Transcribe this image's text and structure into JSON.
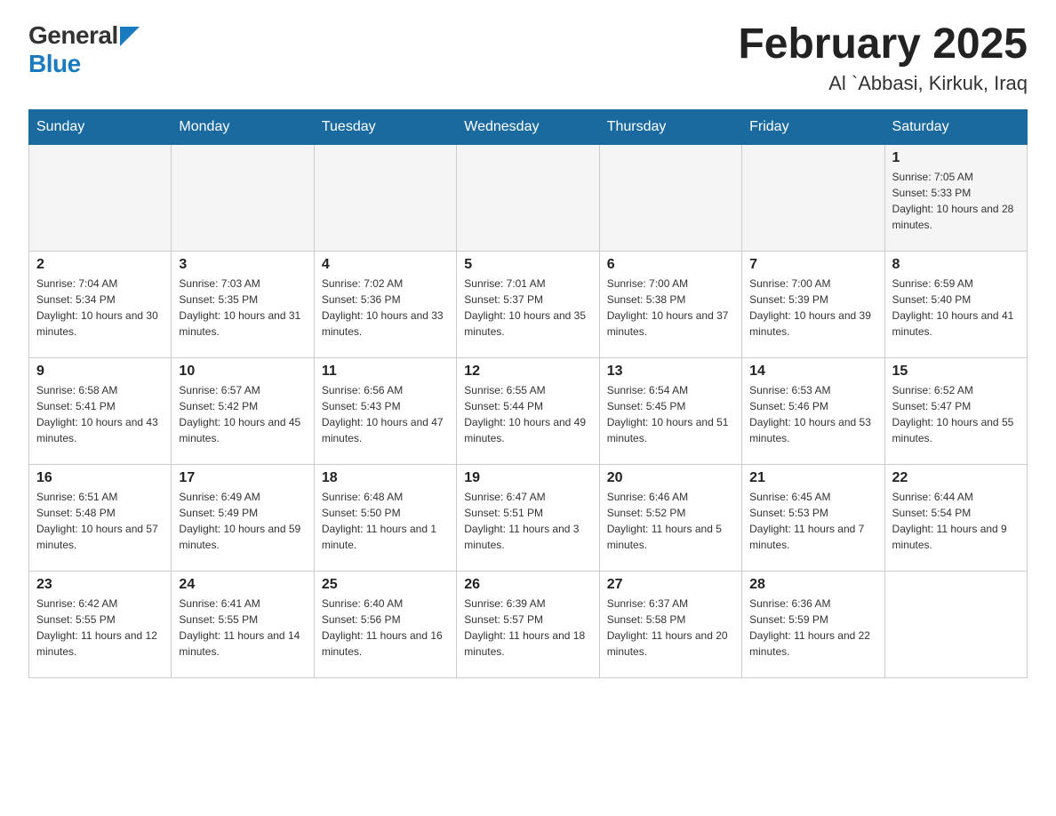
{
  "header": {
    "logo_general": "General",
    "logo_blue": "Blue",
    "title": "February 2025",
    "location": "Al `Abbasi, Kirkuk, Iraq"
  },
  "days_of_week": [
    "Sunday",
    "Monday",
    "Tuesday",
    "Wednesday",
    "Thursday",
    "Friday",
    "Saturday"
  ],
  "weeks": [
    [
      {
        "day": "",
        "info": ""
      },
      {
        "day": "",
        "info": ""
      },
      {
        "day": "",
        "info": ""
      },
      {
        "day": "",
        "info": ""
      },
      {
        "day": "",
        "info": ""
      },
      {
        "day": "",
        "info": ""
      },
      {
        "day": "1",
        "info": "Sunrise: 7:05 AM\nSunset: 5:33 PM\nDaylight: 10 hours and 28 minutes."
      }
    ],
    [
      {
        "day": "2",
        "info": "Sunrise: 7:04 AM\nSunset: 5:34 PM\nDaylight: 10 hours and 30 minutes."
      },
      {
        "day": "3",
        "info": "Sunrise: 7:03 AM\nSunset: 5:35 PM\nDaylight: 10 hours and 31 minutes."
      },
      {
        "day": "4",
        "info": "Sunrise: 7:02 AM\nSunset: 5:36 PM\nDaylight: 10 hours and 33 minutes."
      },
      {
        "day": "5",
        "info": "Sunrise: 7:01 AM\nSunset: 5:37 PM\nDaylight: 10 hours and 35 minutes."
      },
      {
        "day": "6",
        "info": "Sunrise: 7:00 AM\nSunset: 5:38 PM\nDaylight: 10 hours and 37 minutes."
      },
      {
        "day": "7",
        "info": "Sunrise: 7:00 AM\nSunset: 5:39 PM\nDaylight: 10 hours and 39 minutes."
      },
      {
        "day": "8",
        "info": "Sunrise: 6:59 AM\nSunset: 5:40 PM\nDaylight: 10 hours and 41 minutes."
      }
    ],
    [
      {
        "day": "9",
        "info": "Sunrise: 6:58 AM\nSunset: 5:41 PM\nDaylight: 10 hours and 43 minutes."
      },
      {
        "day": "10",
        "info": "Sunrise: 6:57 AM\nSunset: 5:42 PM\nDaylight: 10 hours and 45 minutes."
      },
      {
        "day": "11",
        "info": "Sunrise: 6:56 AM\nSunset: 5:43 PM\nDaylight: 10 hours and 47 minutes."
      },
      {
        "day": "12",
        "info": "Sunrise: 6:55 AM\nSunset: 5:44 PM\nDaylight: 10 hours and 49 minutes."
      },
      {
        "day": "13",
        "info": "Sunrise: 6:54 AM\nSunset: 5:45 PM\nDaylight: 10 hours and 51 minutes."
      },
      {
        "day": "14",
        "info": "Sunrise: 6:53 AM\nSunset: 5:46 PM\nDaylight: 10 hours and 53 minutes."
      },
      {
        "day": "15",
        "info": "Sunrise: 6:52 AM\nSunset: 5:47 PM\nDaylight: 10 hours and 55 minutes."
      }
    ],
    [
      {
        "day": "16",
        "info": "Sunrise: 6:51 AM\nSunset: 5:48 PM\nDaylight: 10 hours and 57 minutes."
      },
      {
        "day": "17",
        "info": "Sunrise: 6:49 AM\nSunset: 5:49 PM\nDaylight: 10 hours and 59 minutes."
      },
      {
        "day": "18",
        "info": "Sunrise: 6:48 AM\nSunset: 5:50 PM\nDaylight: 11 hours and 1 minute."
      },
      {
        "day": "19",
        "info": "Sunrise: 6:47 AM\nSunset: 5:51 PM\nDaylight: 11 hours and 3 minutes."
      },
      {
        "day": "20",
        "info": "Sunrise: 6:46 AM\nSunset: 5:52 PM\nDaylight: 11 hours and 5 minutes."
      },
      {
        "day": "21",
        "info": "Sunrise: 6:45 AM\nSunset: 5:53 PM\nDaylight: 11 hours and 7 minutes."
      },
      {
        "day": "22",
        "info": "Sunrise: 6:44 AM\nSunset: 5:54 PM\nDaylight: 11 hours and 9 minutes."
      }
    ],
    [
      {
        "day": "23",
        "info": "Sunrise: 6:42 AM\nSunset: 5:55 PM\nDaylight: 11 hours and 12 minutes."
      },
      {
        "day": "24",
        "info": "Sunrise: 6:41 AM\nSunset: 5:55 PM\nDaylight: 11 hours and 14 minutes."
      },
      {
        "day": "25",
        "info": "Sunrise: 6:40 AM\nSunset: 5:56 PM\nDaylight: 11 hours and 16 minutes."
      },
      {
        "day": "26",
        "info": "Sunrise: 6:39 AM\nSunset: 5:57 PM\nDaylight: 11 hours and 18 minutes."
      },
      {
        "day": "27",
        "info": "Sunrise: 6:37 AM\nSunset: 5:58 PM\nDaylight: 11 hours and 20 minutes."
      },
      {
        "day": "28",
        "info": "Sunrise: 6:36 AM\nSunset: 5:59 PM\nDaylight: 11 hours and 22 minutes."
      },
      {
        "day": "",
        "info": ""
      }
    ]
  ]
}
